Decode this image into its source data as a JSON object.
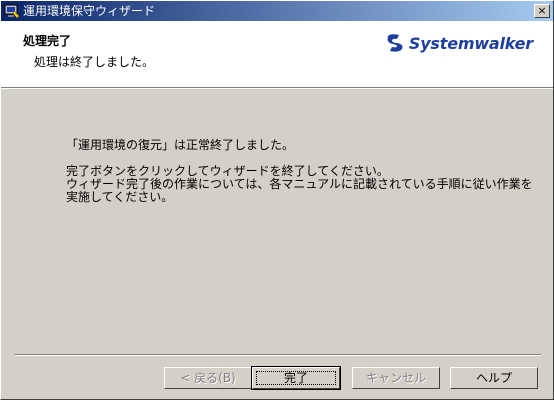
{
  "window": {
    "title": "運用環境保守ウィザード",
    "close_label": "×"
  },
  "header": {
    "title": "処理完了",
    "subtitle": "処理は終了しました。",
    "logo_text": "Systemwalker"
  },
  "body": {
    "lines": [
      "「運用環境の復元」は正常終了しました。",
      "完了ボタンをクリックしてウィザードを終了してください。",
      "ウィザード完了後の作業については、各マニュアルに記載されている手順に従い作業を",
      "実施してください。"
    ]
  },
  "buttons": {
    "back": "< 戻る(B)",
    "finish": "完了",
    "cancel": "キャンセル",
    "help": "ヘルプ"
  },
  "colors": {
    "title_start": "#0a246a",
    "title_end": "#a6caf0",
    "logo": "#1f3f9f",
    "dialog_bg": "#d4d0c8"
  }
}
